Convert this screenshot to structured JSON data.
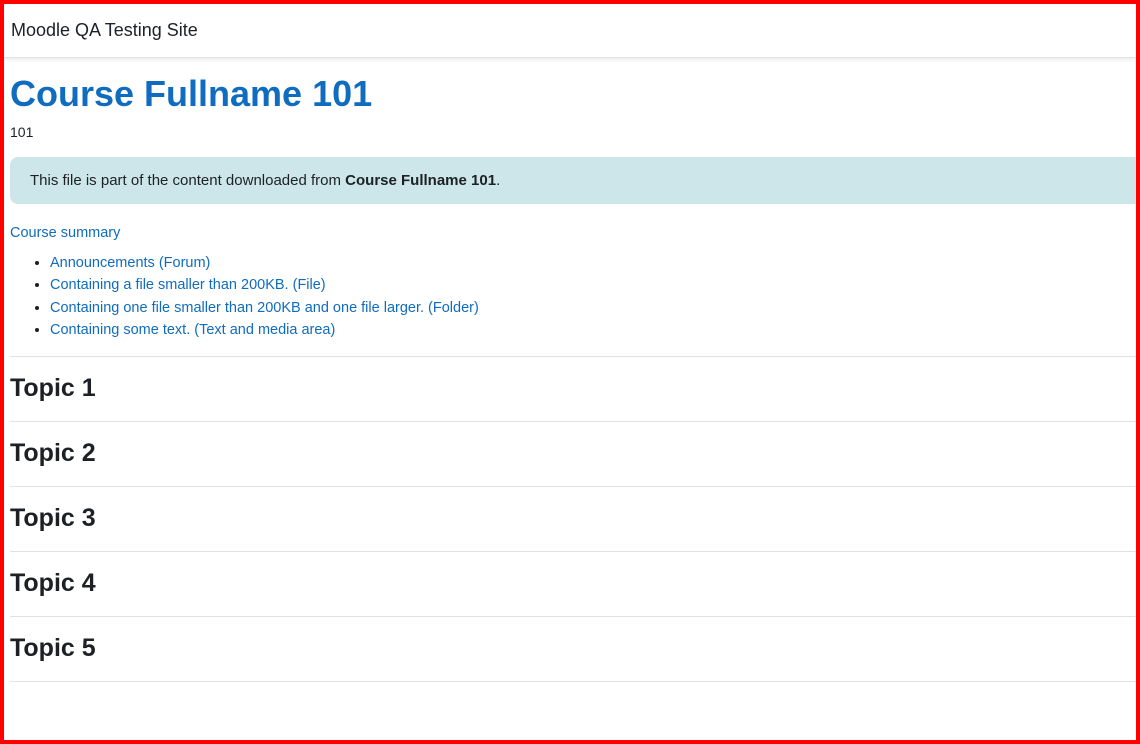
{
  "header": {
    "site_name": "Moodle QA Testing Site"
  },
  "course": {
    "fullname": "Course Fullname 101",
    "shortname": "101"
  },
  "notice": {
    "text_prefix": "This file is part of the content downloaded from ",
    "course_name": "Course Fullname 101",
    "text_suffix": "."
  },
  "summary_link": "Course summary",
  "activities": [
    {
      "label": "Announcements (Forum)"
    },
    {
      "label": "Containing a file smaller than 200KB. (File)"
    },
    {
      "label": "Containing one file smaller than 200KB and one file larger. (Folder)"
    },
    {
      "label": "Containing some text. (Text and media area)"
    }
  ],
  "topics": [
    {
      "title": "Topic 1"
    },
    {
      "title": "Topic 2"
    },
    {
      "title": "Topic 3"
    },
    {
      "title": "Topic 4"
    },
    {
      "title": "Topic 5"
    }
  ],
  "colors": {
    "frame_border": "#ff0000",
    "link": "#0f6cbf",
    "notice_bg": "#cce6ea",
    "text": "#1d2125"
  }
}
